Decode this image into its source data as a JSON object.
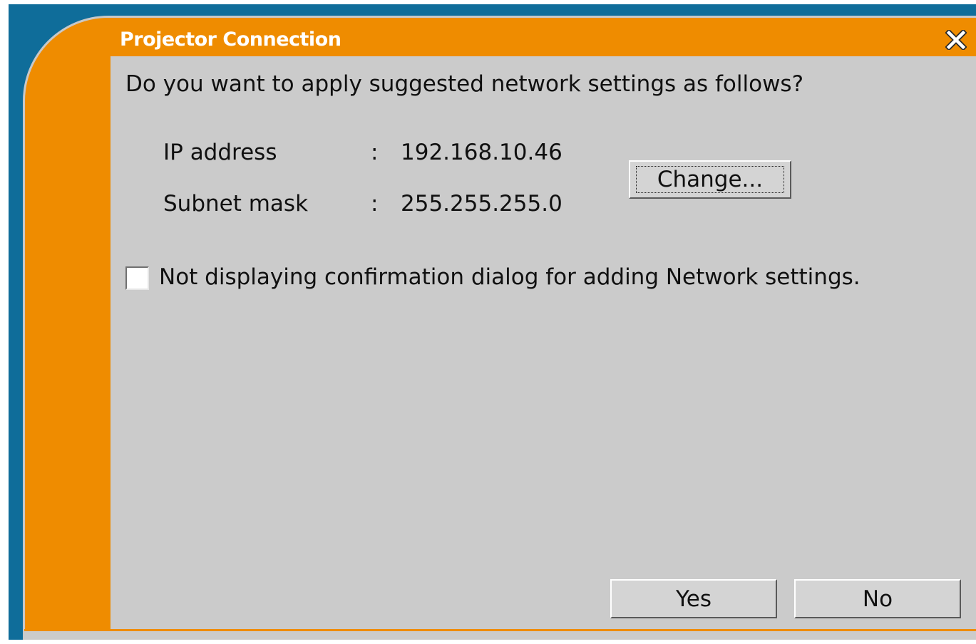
{
  "window": {
    "title": "Projector Connection",
    "colors": {
      "frame": "#0f6d9a",
      "accent": "#ef8c00",
      "panel": "#cbcbcb"
    }
  },
  "dialog": {
    "question": "Do you want to apply suggested network settings as follows?",
    "fields": [
      {
        "label": "IP address",
        "separator": ":",
        "value": "192.168.10.46"
      },
      {
        "label": "Subnet mask",
        "separator": ":",
        "value": "255.255.255.0"
      }
    ],
    "change_label": "Change...",
    "checkbox": {
      "label": "Not displaying confirmation dialog for adding Network settings.",
      "checked": false
    }
  },
  "buttons": {
    "yes_label": "Yes",
    "no_label": "No"
  },
  "icons": {
    "close": "close-icon"
  }
}
